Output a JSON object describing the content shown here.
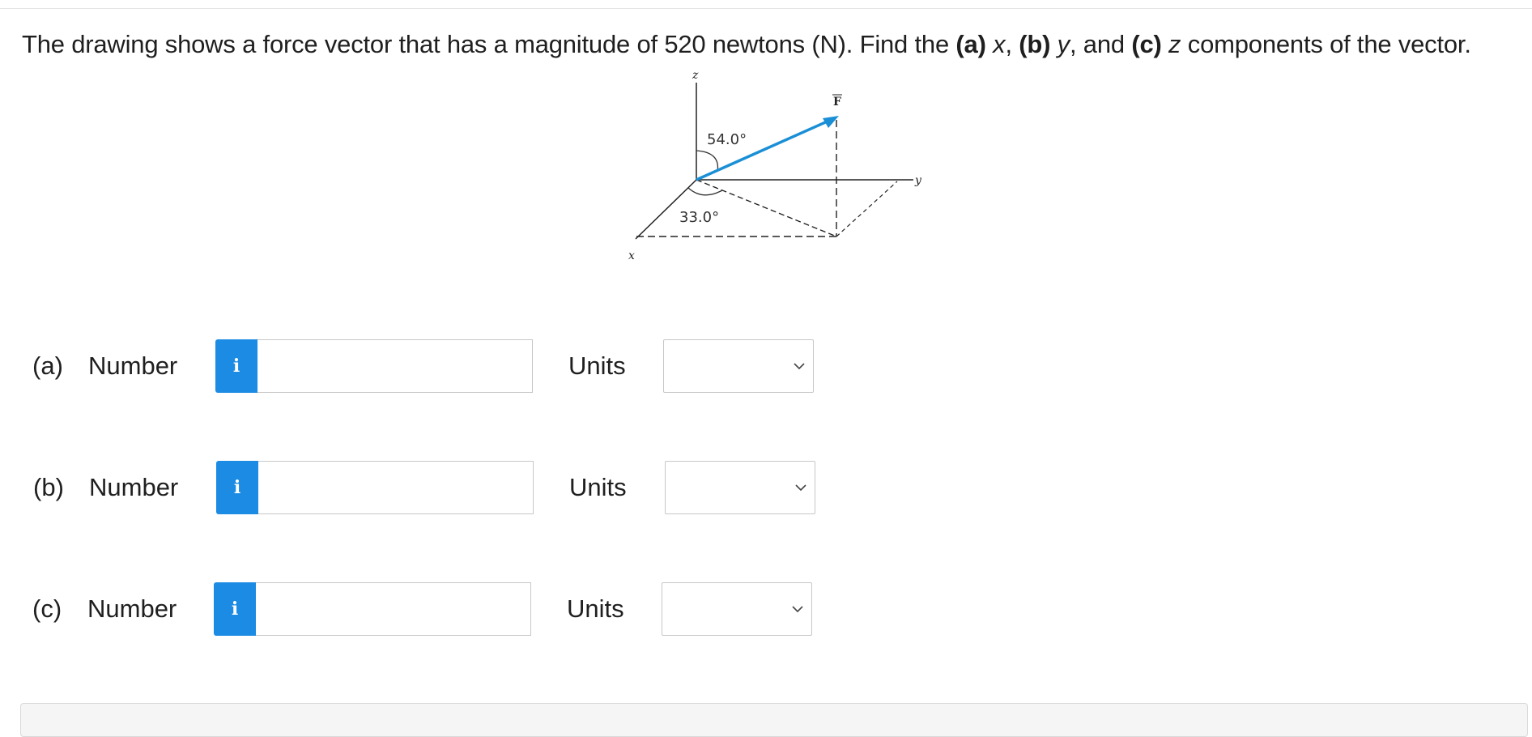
{
  "question": {
    "part1": "The drawing shows a force vector that has a magnitude of 520 newtons (N). Find the ",
    "a_label": "(a)",
    "a_var": " x",
    "sep1": ", ",
    "b_label": "(b)",
    "b_var": " y",
    "sep2": ", and ",
    "c_label": "(c)",
    "c_var": " z",
    "part2": " components of the vector."
  },
  "figure": {
    "axis_z": "z",
    "axis_y": "y",
    "axis_x": "x",
    "vector_label": "F",
    "angle_top": "54.0°",
    "angle_bottom": "33.0°",
    "vector_color": "#1b8fd6"
  },
  "rows": [
    {
      "part": "(a)",
      "number_label": "Number",
      "info_icon": "i",
      "value": "",
      "units_label": "Units",
      "units_selected": ""
    },
    {
      "part": "(b)",
      "number_label": "Number",
      "info_icon": "i",
      "value": "",
      "units_label": "Units",
      "units_selected": ""
    },
    {
      "part": "(c)",
      "number_label": "Number",
      "info_icon": "i",
      "value": "",
      "units_label": "Units",
      "units_selected": ""
    }
  ],
  "colors": {
    "info_button": "#1b8be3"
  }
}
